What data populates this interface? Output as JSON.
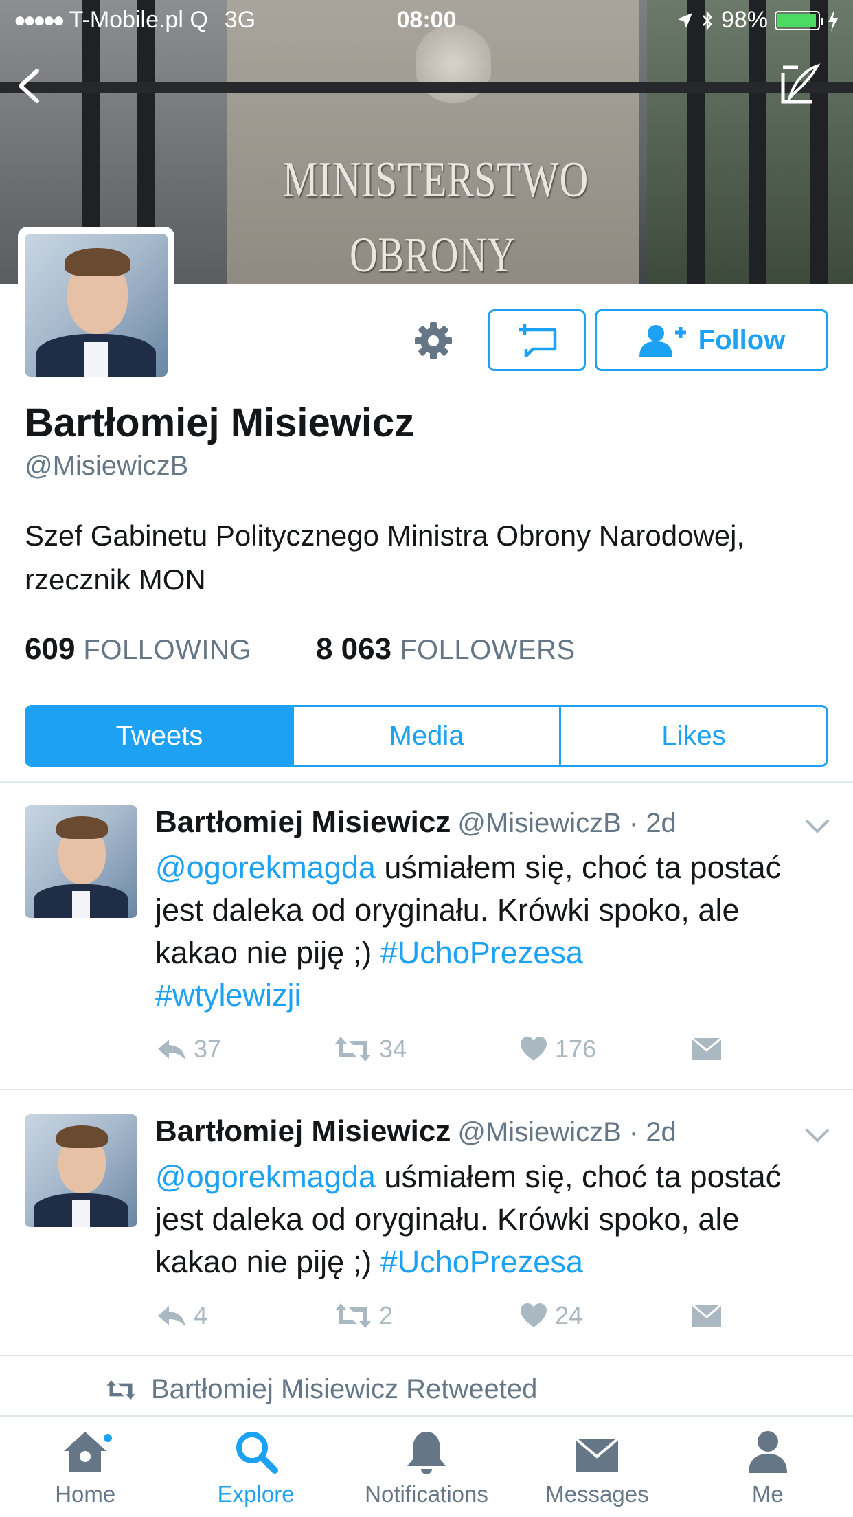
{
  "status_bar": {
    "carrier": "T-Mobile.pl Q",
    "network": "3G",
    "time": "08:00",
    "battery": "98%",
    "battery_color": "#4cd964"
  },
  "banner": {
    "line1": "MINISTERSTWO",
    "line2": "OBRONY NARODOWEJ"
  },
  "profile": {
    "name": "Bartłomiej Misiewicz",
    "handle": "@MisiewiczB",
    "bio": "Szef Gabinetu Politycznego Ministra Obrony Narodowej, rzecznik MON",
    "following_count": "609",
    "following_label": "FOLLOWING",
    "followers_count": "8 063",
    "followers_label": "FOLLOWERS",
    "follow_label": "Follow"
  },
  "tabs": [
    {
      "label": "Tweets",
      "active": true
    },
    {
      "label": "Media",
      "active": false
    },
    {
      "label": "Likes",
      "active": false
    }
  ],
  "tweets": [
    {
      "name": "Bartłomiej Misiewicz",
      "handle": "@MisiewiczB",
      "time": "2d",
      "mention": "@ogorekmagda",
      "text": " uśmiałem się, choć ta postać jest daleka od oryginału. Krówki spoko, ale kakao nie piję ;) ",
      "hashtag1": "#UchoPrezesa",
      "hashtag2": "#wtylewizji",
      "replies": "37",
      "retweets": "34",
      "likes": "176"
    },
    {
      "name": "Bartłomiej Misiewicz",
      "handle": "@MisiewiczB",
      "time": "2d",
      "mention": "@ogorekmagda",
      "text": " uśmiałem się, choć ta postać jest daleka od oryginału. Krówki spoko, ale kakao nie piję ;) ",
      "hashtag1": "#UchoPrezesa",
      "replies": "4",
      "retweets": "2",
      "likes": "24"
    }
  ],
  "retweeted_label": "Bartłomiej Misiewicz Retweeted",
  "tab_bar": [
    {
      "label": "Home",
      "icon": "home-icon"
    },
    {
      "label": "Explore",
      "icon": "search-icon",
      "active": true
    },
    {
      "label": "Notifications",
      "icon": "bell-icon"
    },
    {
      "label": "Messages",
      "icon": "envelope-icon"
    },
    {
      "label": "Me",
      "icon": "person-icon"
    }
  ],
  "colors": {
    "accent": "#1da1f2",
    "muted_text": "#657786",
    "action_gray": "#aab8c2"
  }
}
